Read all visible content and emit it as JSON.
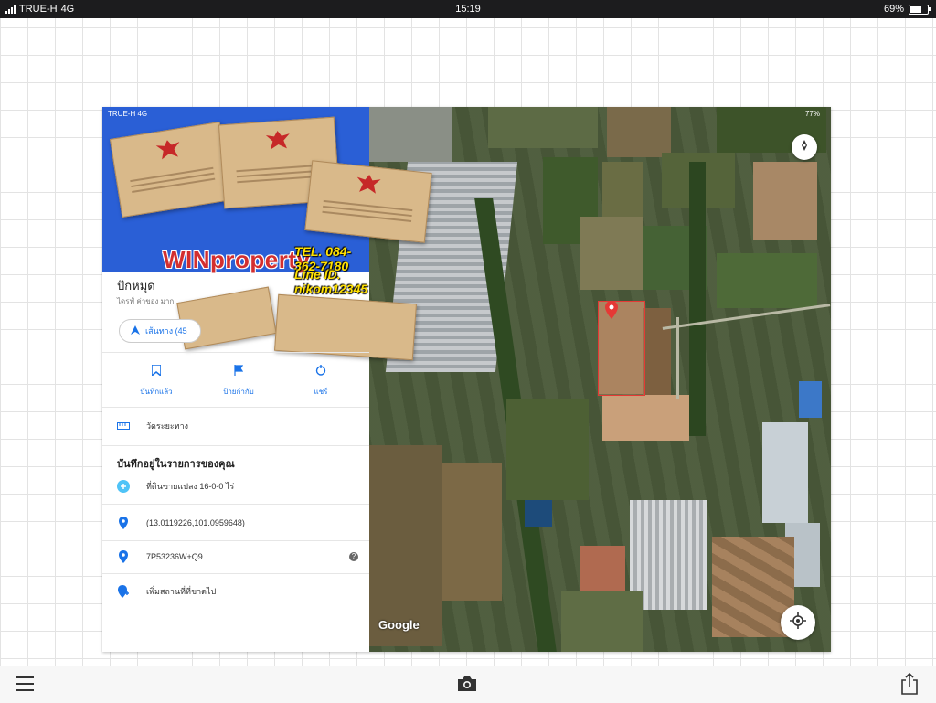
{
  "status_bar": {
    "carrier": "TRUE-H",
    "network": "4G",
    "time": "15:19",
    "battery": "69%"
  },
  "photo": {
    "inner_status": {
      "carrier": "TRUE-H",
      "network": "4G",
      "battery": "77%"
    },
    "watermark": {
      "brand": "WINproperty",
      "tel": "TEL. 084-362-7180",
      "line_id": "Line ID. nikom12345"
    },
    "panel": {
      "title": "ปักหมุด",
      "subtitle": "ไดรฟ์ ค่าของ มาก",
      "directions_label": "เส้นทาง (45",
      "actions": [
        {
          "label": "บันทึกแล้ว",
          "icon": "bookmark-icon"
        },
        {
          "label": "ป้ายกำกับ",
          "icon": "flag-icon"
        },
        {
          "label": "แชร์",
          "icon": "share-icon"
        }
      ],
      "category": "วัดระยะทาง",
      "section_title": "บันทึกอยู่ในรายการของคุณ",
      "rows": [
        {
          "icon": "note-icon",
          "text": "ที่ดินขายแปลง 16-0-0 ไร่"
        },
        {
          "icon": "location-pin-icon",
          "text": "(13.0119226,101.0959648)"
        },
        {
          "icon": "plus-code-icon",
          "text": "7P53236W+Q9"
        },
        {
          "icon": "add-place-icon",
          "text": "เพิ่มสถานที่ที่ขาดไป"
        }
      ]
    },
    "map": {
      "logo": "Google"
    }
  },
  "toolbar": {
    "menu": "menu-icon",
    "camera": "camera-icon",
    "share": "share-icon"
  }
}
